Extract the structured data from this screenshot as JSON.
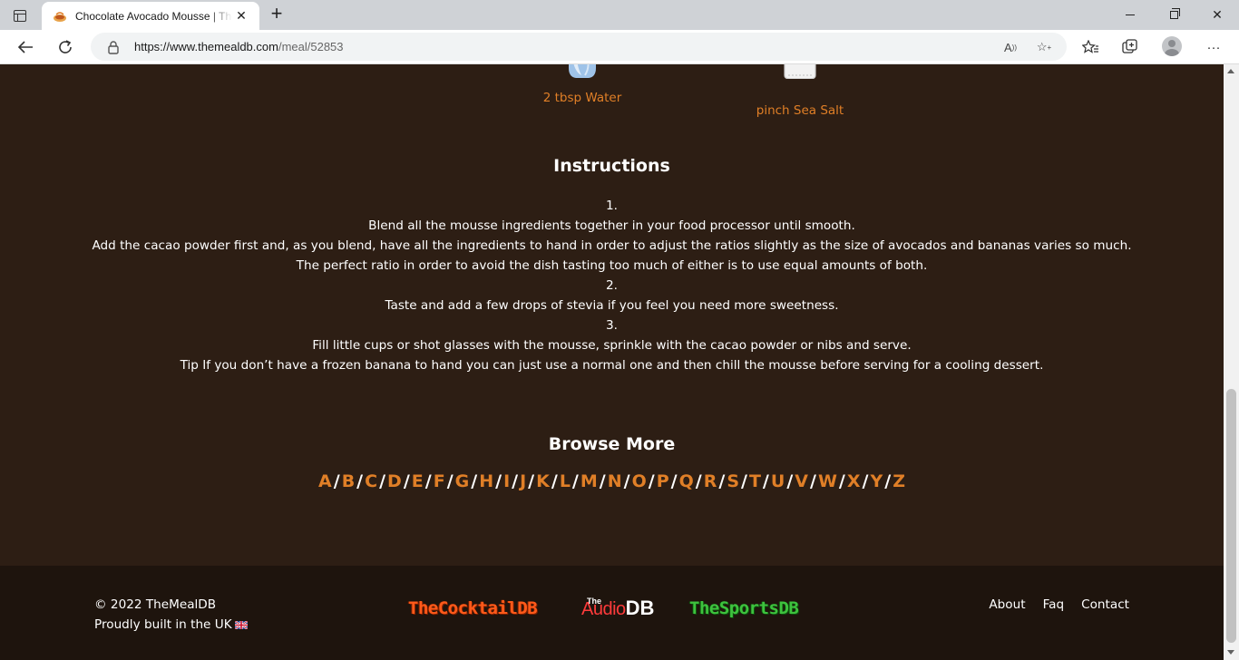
{
  "browser": {
    "tab_title": "Chocolate Avocado Mousse | TheMealDB",
    "url_host": "https://www.themealdb.com",
    "url_path": "/meal/52853"
  },
  "ingredients": [
    {
      "label": "2 tbsp Water"
    },
    {
      "label": "pinch Sea Salt"
    }
  ],
  "instructions": {
    "title": "Instructions",
    "lines": [
      "1.",
      "Blend all the mousse ingredients together in your food processor until smooth.",
      "Add the cacao powder first and, as you blend, have all the ingredients to hand in order to adjust the ratios slightly as the size of avocados and bananas varies so much.",
      "The perfect ratio in order to avoid the dish tasting too much of either is to use equal amounts of both.",
      "2.",
      "Taste and add a few drops of stevia if you feel you need more sweetness.",
      "3.",
      "Fill little cups or shot glasses with the mousse, sprinkle with the cacao powder or nibs and serve.",
      "Tip If you don’t have a frozen banana to hand you can just use a normal one and then chill the mousse before serving for a cooling dessert."
    ]
  },
  "browse": {
    "title": "Browse More",
    "letters": [
      "A",
      "B",
      "C",
      "D",
      "E",
      "F",
      "G",
      "H",
      "I",
      "J",
      "K",
      "L",
      "M",
      "N",
      "O",
      "P",
      "Q",
      "R",
      "S",
      "T",
      "U",
      "V",
      "W",
      "X",
      "Y",
      "Z"
    ],
    "separator": "/"
  },
  "footer": {
    "copyright": "© 2022 TheMealDB",
    "built": "Proudly built in the UK",
    "logos": {
      "cocktail": "TheCocktailDB",
      "audio_the": "The",
      "audio_main": "Audio",
      "audio_db": "DB",
      "sports": "TheSportsDB"
    },
    "links": [
      "About",
      "Faq",
      "Contact"
    ]
  },
  "colors": {
    "page_bg": "#2d1e14",
    "footer_bg": "#1e140d",
    "accent": "#e07f27"
  }
}
